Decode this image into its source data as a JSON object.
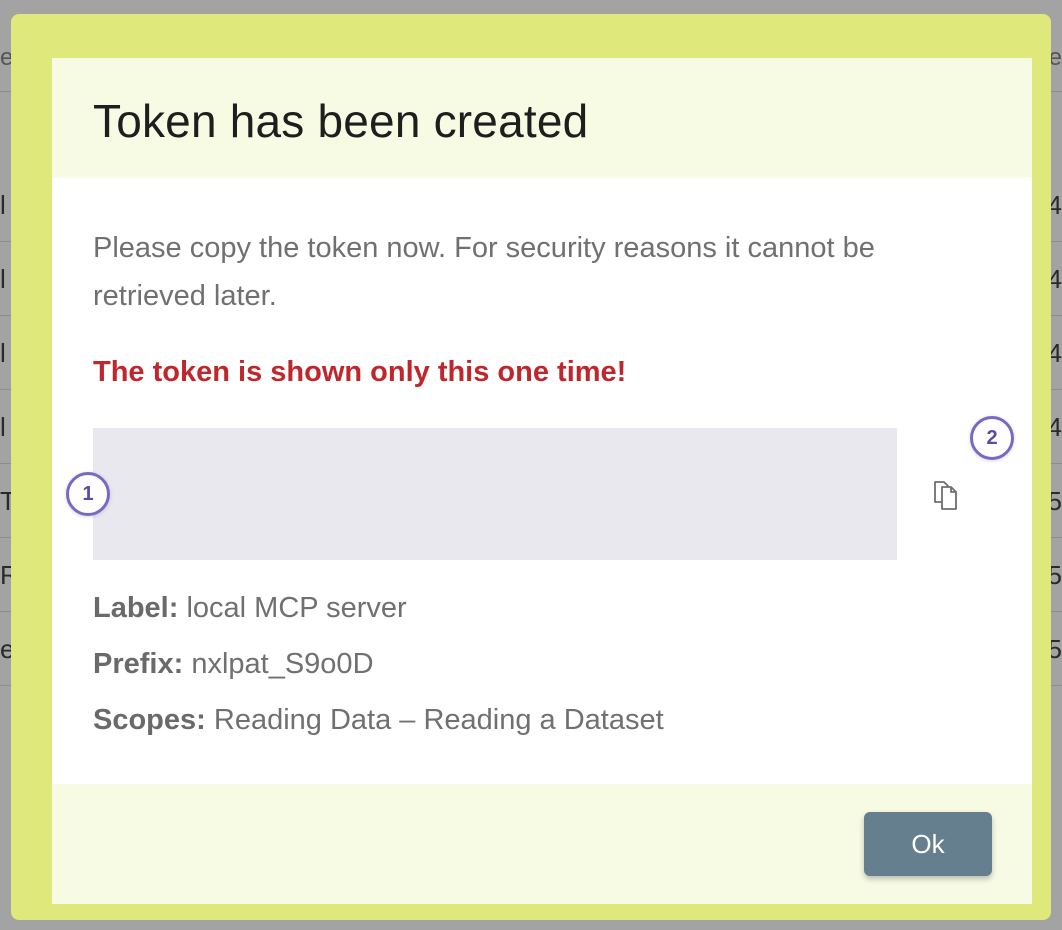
{
  "background": {
    "header": {
      "left": "e",
      "right": "e"
    },
    "rows": [
      {
        "left": "l",
        "right": "4"
      },
      {
        "left": "l",
        "right": "4"
      },
      {
        "left": "l",
        "right": "4"
      },
      {
        "left": "l",
        "right": "4"
      },
      {
        "left": "T",
        "right": "5"
      },
      {
        "left": "R",
        "right": "5"
      },
      {
        "left": "e",
        "right": "5"
      }
    ]
  },
  "dialog": {
    "title": "Token has been created",
    "description": "Please copy the token now. For security reasons it cannot be retrieved later.",
    "warning": "The token is shown only this one time!",
    "token_value": "",
    "badges": {
      "first": "1",
      "second": "2"
    },
    "meta": {
      "label_key": "Label:",
      "label_value": " local MCP server",
      "prefix_key": "Prefix:",
      "prefix_value": " nxlpat_S9o0D",
      "scopes_key": "Scopes:",
      "scopes_value": " Reading Data – Reading a Dataset"
    },
    "ok_label": "Ok"
  },
  "colors": {
    "frame": "#dfe87a",
    "warning": "#c0272d",
    "ok_button": "#657f8e",
    "badge_border": "#7b68c4"
  },
  "icons": {
    "copy": "copy-icon"
  }
}
